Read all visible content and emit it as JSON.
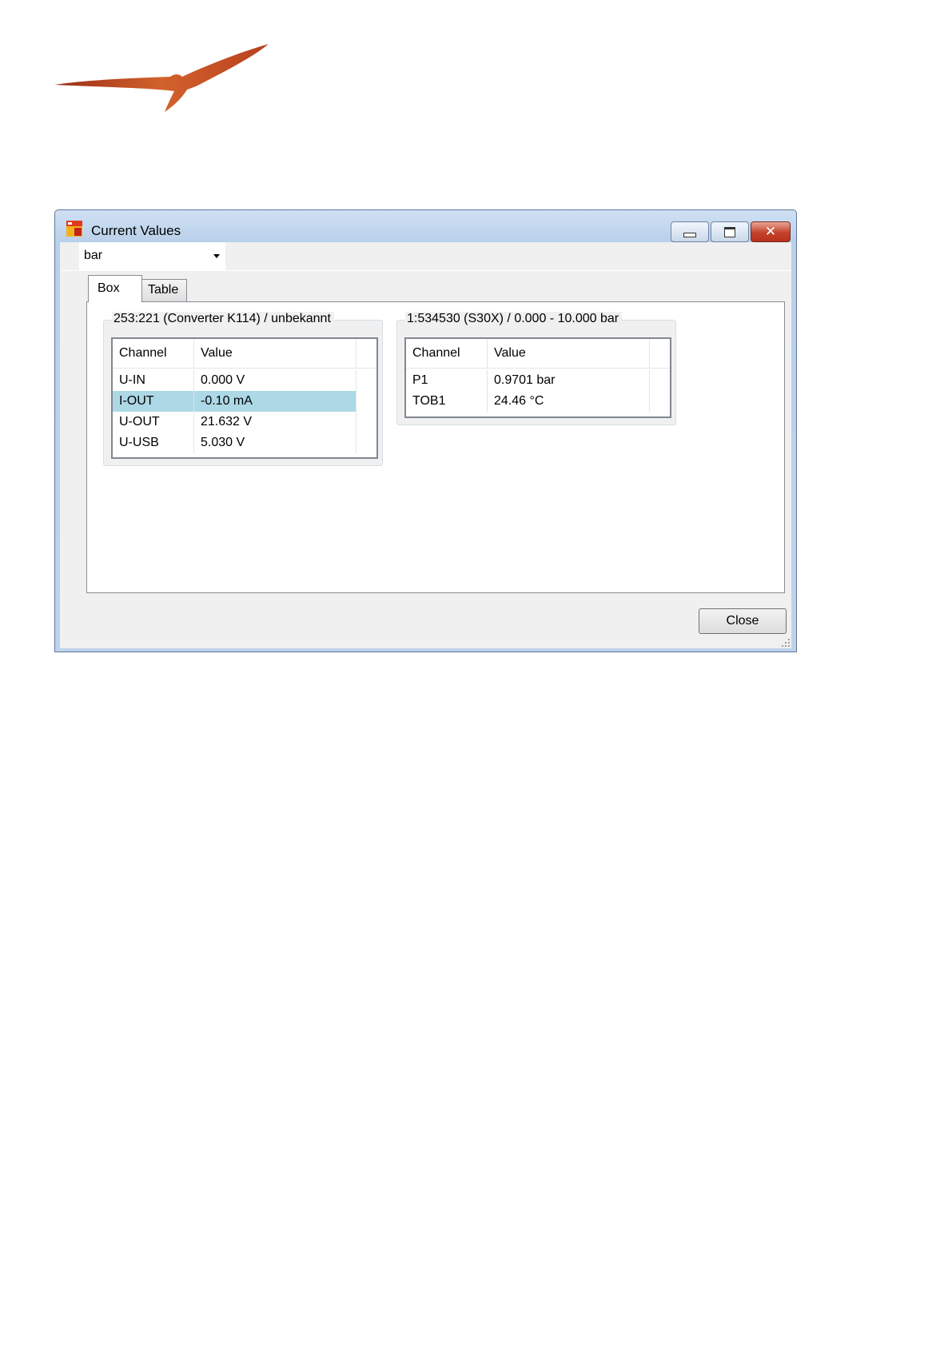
{
  "window": {
    "title": "Current Values",
    "controls": {
      "minimize_icon": "minimize-icon",
      "maximize_icon": "maximize-icon",
      "close_glyph": "✕"
    }
  },
  "toolbar": {
    "unit_select": {
      "value": "bar",
      "options_visible": [
        "bar"
      ]
    }
  },
  "tabs": [
    {
      "label": "Box",
      "active": true
    },
    {
      "label": "Table",
      "active": false
    }
  ],
  "devices": [
    {
      "title": "253:221 (Converter K114) / unbekannt",
      "columns": [
        "Channel",
        "Value"
      ],
      "rows": [
        {
          "channel": "U-IN",
          "value": "0.000 V",
          "selected": false
        },
        {
          "channel": "I-OUT",
          "value": "-0.10 mA",
          "selected": true
        },
        {
          "channel": "U-OUT",
          "value": "21.632 V",
          "selected": false
        },
        {
          "channel": "U-USB",
          "value": "5.030 V",
          "selected": false
        }
      ]
    },
    {
      "title": "1:534530 (S30X) / 0.000 - 10.000 bar",
      "columns": [
        "Channel",
        "Value"
      ],
      "rows": [
        {
          "channel": "P1",
          "value": "0.9701 bar",
          "selected": false
        },
        {
          "channel": "TOB1",
          "value": "24.46 °C",
          "selected": false
        }
      ]
    }
  ],
  "footer": {
    "close_label": "Close"
  },
  "colors": {
    "selection": "#add8e6",
    "logo_bird": "#b8401f",
    "title_gradient_top": "#cfe0f3"
  }
}
